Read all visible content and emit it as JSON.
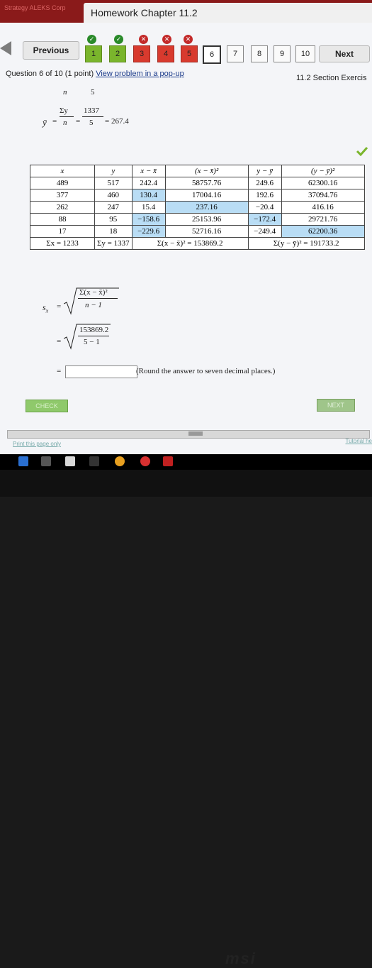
{
  "app": {
    "brand": "Strategy ALEKS Corp",
    "title": "Homework Chapter 11.2"
  },
  "nav": {
    "previous": "Previous",
    "next": "Next",
    "questions": [
      "1",
      "2",
      "3",
      "4",
      "5",
      "6",
      "7",
      "8",
      "9",
      "10"
    ]
  },
  "question": {
    "header": "Question 6 of 10 (1 point)",
    "popup_link": "View problem in a pop-up",
    "section": "11.2 Section Exercis"
  },
  "stats": {
    "n_label": "n",
    "n_value": "5",
    "ybar": "ȳ",
    "sum_y": "Σy",
    "sum_y_value": "1337",
    "n_denom": "5",
    "ybar_result": "= 267.4",
    "sx": "s",
    "sx_sub": "x",
    "formula_top": "Σ(x − x̄)²",
    "formula_bottom": "n − 1",
    "num_value": "153869.2",
    "den_value": "5 − 1",
    "round_note": "(Round the answer to seven decimal places.)"
  },
  "table": {
    "headers": [
      "x",
      "y",
      "x − x̄",
      "(x − x̄)²",
      "y − ȳ",
      "(y − ȳ)²"
    ],
    "rows": [
      [
        "489",
        "517",
        "242.4",
        "58757.76",
        "249.6",
        "62300.16"
      ],
      [
        "377",
        "460",
        "130.4",
        "17004.16",
        "192.6",
        "37094.76"
      ],
      [
        "262",
        "247",
        "15.4",
        "237.16",
        "−20.4",
        "416.16"
      ],
      [
        "88",
        "95",
        "−158.6",
        "25153.96",
        "−172.4",
        "29721.76"
      ],
      [
        "17",
        "18",
        "−229.6",
        "52716.16",
        "−249.4",
        "62200.36"
      ]
    ],
    "totals": [
      "Σx = 1233",
      "Σy = 1337",
      "Σ(x − x̄)² = 153869.2",
      "Σ(y − ȳ)² = 191733.2"
    ]
  },
  "buttons": {
    "check": "CHECK",
    "next": "NEXT"
  },
  "footer": {
    "print": "Print this page only",
    "tutorial": "Tutorial he"
  },
  "brand_bezel": "msi",
  "colors": {
    "correct": "#7ab52c",
    "incorrect": "#d83a2e",
    "highlight": "#b9ddf5",
    "title_bar": "#8a1a1a"
  }
}
